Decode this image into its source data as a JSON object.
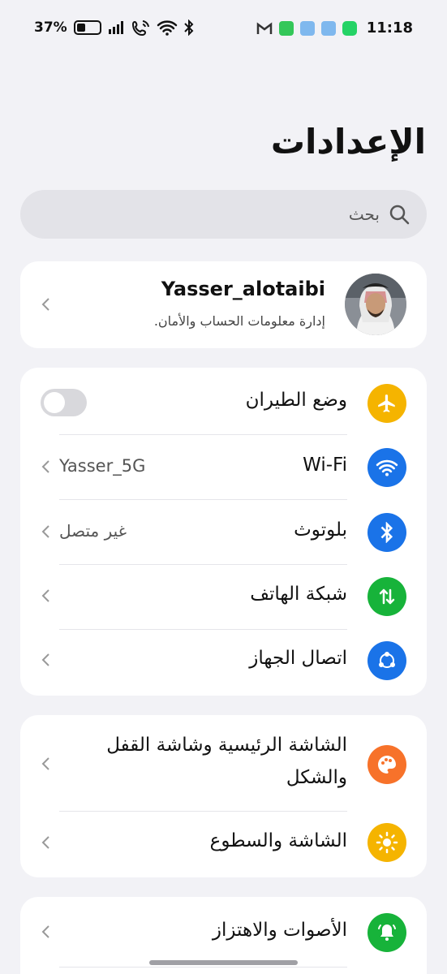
{
  "status_bar": {
    "battery": "37%",
    "time": "11:18"
  },
  "page": {
    "title": "الإعدادات"
  },
  "search": {
    "placeholder": "بحث"
  },
  "account": {
    "name": "Yasser_alotaibi",
    "subtitle": "إدارة معلومات الحساب والأمان."
  },
  "connectivity": {
    "items": [
      {
        "label": "وضع الطيران",
        "icon": "airplane-icon",
        "color": "#f5b400",
        "toggle": false
      },
      {
        "label": "Wi-Fi",
        "value": "Yasser_5G",
        "icon": "wifi-icon",
        "color": "#1a73e8"
      },
      {
        "label": "بلوتوث",
        "value": "غير متصل",
        "icon": "bluetooth-icon",
        "color": "#1a73e8"
      },
      {
        "label": "شبكة الهاتف",
        "icon": "mobile-network-icon",
        "color": "#17b33a"
      },
      {
        "label": "اتصال الجهاز",
        "icon": "device-connection-icon",
        "color": "#1a73e8"
      }
    ]
  },
  "display": {
    "items": [
      {
        "label_line1": "الشاشة الرئيسية وشاشة القفل",
        "label_line2": "والشكل",
        "icon": "palette-icon",
        "color": "#f7722a"
      },
      {
        "label": "الشاشة والسطوع",
        "icon": "brightness-icon",
        "color": "#f5b400"
      }
    ]
  },
  "sound": {
    "items": [
      {
        "label": "الأصوات والاهتزاز",
        "icon": "bell-icon",
        "color": "#17b33a"
      }
    ]
  }
}
